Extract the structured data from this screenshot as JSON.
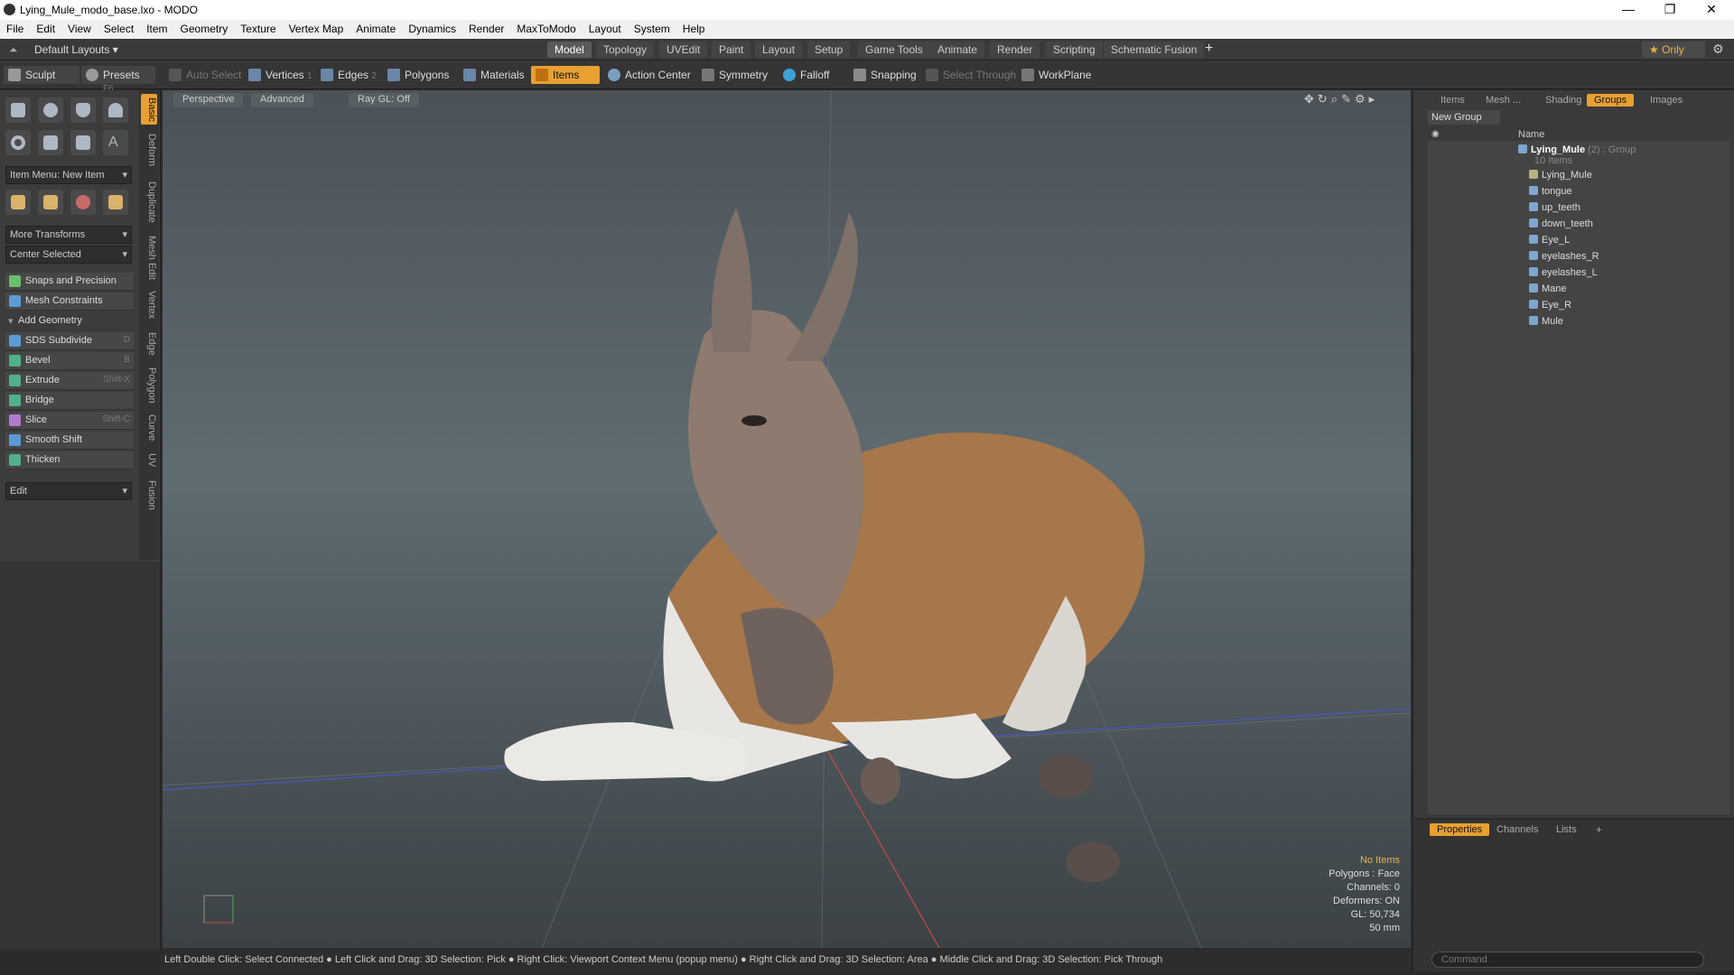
{
  "window": {
    "title": "Lying_Mule_modo_base.lxo - MODO",
    "minimize": "—",
    "maximize": "❐",
    "close": "✕"
  },
  "menu": [
    "File",
    "Edit",
    "View",
    "Select",
    "Item",
    "Geometry",
    "Texture",
    "Vertex Map",
    "Animate",
    "Dynamics",
    "Render",
    "MaxToModo",
    "Layout",
    "System",
    "Help"
  ],
  "layout": {
    "selector": "Default Layouts ▾",
    "tabs": [
      "Model",
      "Topology",
      "UVEdit",
      "Paint",
      "Layout",
      "Setup",
      "Game Tools",
      "Animate",
      "Render",
      "Scripting",
      "Schematic Fusion"
    ],
    "active_tab": "Model",
    "add": "+",
    "only": "★  Only"
  },
  "toolbar": {
    "sculpt": "Sculpt",
    "presets": "Presets",
    "presets_key": "F6",
    "auto_select": "Auto Select",
    "vertices": "Vertices",
    "vertices_count": "1",
    "edges": "Edges",
    "edges_count": "2",
    "polygons": "Polygons",
    "materials": "Materials",
    "items": "Items",
    "action_center": "Action Center",
    "symmetry": "Symmetry",
    "falloff": "Falloff",
    "snapping": "Snapping",
    "select_through": "Select Through",
    "workplane": "WorkPlane"
  },
  "left_tabs": [
    "Basic",
    "Deform",
    "Duplicate",
    "Mesh Edit",
    "Vertex",
    "Edge",
    "Polygon",
    "Curve",
    "UV",
    "Fusion"
  ],
  "left": {
    "item_menu": "Item Menu: New Item",
    "more_transforms": "More Transforms",
    "center_selected": "Center Selected",
    "snaps": "Snaps and Precision",
    "mesh_constraints": "Mesh Constraints",
    "add_geometry": "Add Geometry",
    "tools": [
      {
        "label": "SDS Subdivide",
        "key": "D"
      },
      {
        "label": "Bevel",
        "key": "B"
      },
      {
        "label": "Extrude",
        "key": "Shift-X"
      },
      {
        "label": "Bridge",
        "key": ""
      },
      {
        "label": "Slice",
        "key": "Shift-C"
      },
      {
        "label": "Smooth Shift",
        "key": ""
      },
      {
        "label": "Thicken",
        "key": ""
      }
    ],
    "edit": "Edit"
  },
  "viewport": {
    "perspective": "Perspective",
    "advanced": "Advanced",
    "raygl": "Ray GL: Off",
    "info": {
      "no_items": "No Items",
      "polygons": "Polygons : Face",
      "channels": "Channels: 0",
      "deformers": "Deformers: ON",
      "gl": "GL: 50,734",
      "mm": "50 mm"
    }
  },
  "status": "Left Double Click: Select Connected ● Left Click and Drag: 3D Selection: Pick ● Right Click: Viewport Context Menu (popup menu) ● Right Click and Drag: 3D Selection: Area ● Middle Click and Drag: 3D Selection: Pick Through",
  "right": {
    "tabs": [
      "Items",
      "Mesh ...",
      "Shading",
      "Groups",
      "Images"
    ],
    "active_tab": "Groups",
    "new_group": "New Group",
    "col_name": "Name",
    "group_name": "Lying_Mule",
    "group_suffix": "(2) : Group",
    "group_count": "10 Items",
    "items": [
      "Lying_Mule",
      "tongue",
      "up_teeth",
      "down_teeth",
      "Eye_L",
      "eyelashes_R",
      "eyelashes_L",
      "Mane",
      "Eye_R",
      "Mule"
    ],
    "lower_tabs": [
      "Properties",
      "Channels",
      "Lists"
    ],
    "command_placeholder": "Command"
  }
}
